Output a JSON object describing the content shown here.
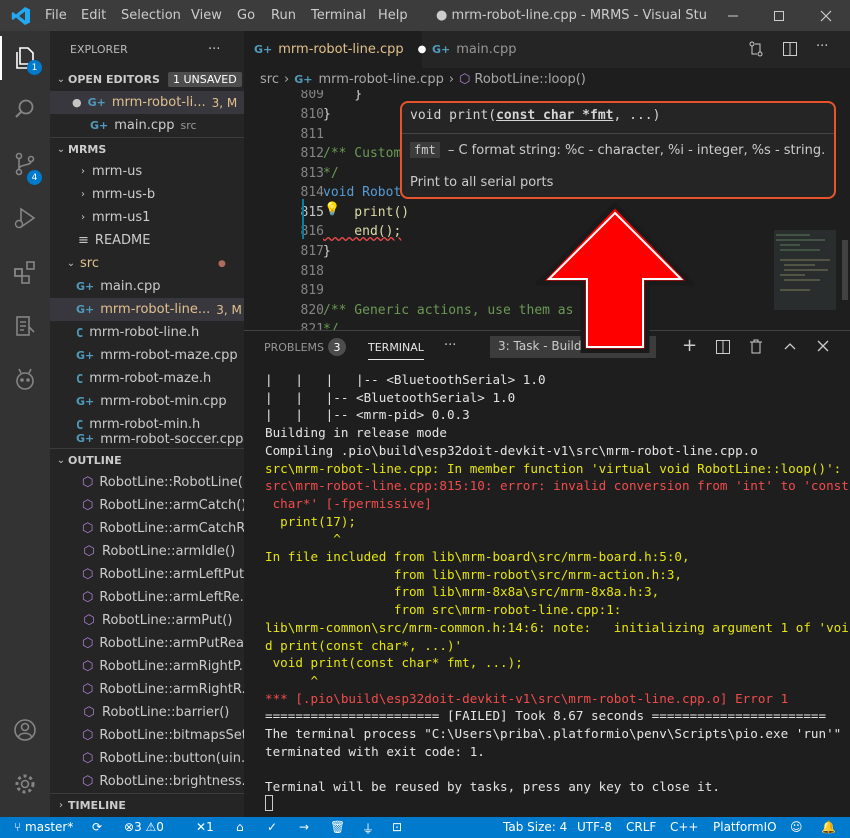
{
  "titlebar": {
    "menus": [
      "File",
      "Edit",
      "Selection",
      "View",
      "Go",
      "Run",
      "Terminal",
      "Help"
    ],
    "title": "● mrm-robot-line.cpp - MRMS - Visual Studio ..."
  },
  "activity": {
    "explorer_badge": "1",
    "scm_badge": "4"
  },
  "sidebar": {
    "header": "EXPLORER",
    "more": "···",
    "open_editors": {
      "label": "OPEN EDITORS",
      "unsaved": "1 UNSAVED",
      "items": [
        {
          "name": "mrm-robot-li...",
          "status": "3, M"
        },
        {
          "name": "main.cpp",
          "dir": "src"
        }
      ]
    },
    "mrms": {
      "label": "MRMS",
      "items": [
        {
          "name": "mrm-us"
        },
        {
          "name": "mrm-us-b"
        },
        {
          "name": "mrm-us1"
        },
        {
          "name": "README"
        },
        {
          "name": "src"
        },
        {
          "name": "main.cpp"
        },
        {
          "name": "mrm-robot-line...",
          "status": "3, M"
        },
        {
          "name": "mrm-robot-line.h"
        },
        {
          "name": "mrm-robot-maze.cpp"
        },
        {
          "name": "mrm-robot-maze.h"
        },
        {
          "name": "mrm-robot-min.cpp"
        },
        {
          "name": "mrm-robot-min.h"
        },
        {
          "name": "mrm-robot-soccer.cpp"
        }
      ]
    },
    "outline": {
      "label": "OUTLINE",
      "items": [
        "RobotLine::RobotLine(...",
        "RobotLine::armCatch()",
        "RobotLine::armCatchR...",
        "RobotLine::armIdle()",
        "RobotLine::armLeftPut()",
        "RobotLine::armLeftRe...",
        "RobotLine::armPut()",
        "RobotLine::armPutRea...",
        "RobotLine::armRightP...",
        "RobotLine::armRightR...",
        "RobotLine::barrier()",
        "RobotLine::bitmapsSet()",
        "RobotLine::button(uin...",
        "RobotLine::brightness..."
      ]
    },
    "timeline": "TIMELINE"
  },
  "tabs": {
    "active": "mrm-robot-line.cpp",
    "second": "main.cpp"
  },
  "breadcrumb": {
    "folder": "src",
    "file": "mrm-robot-line.cpp",
    "symbol": "RobotLine::loop()"
  },
  "editor": {
    "lines": [
      {
        "n": "809",
        "text": "    }"
      },
      {
        "n": "810",
        "text": "}"
      },
      {
        "n": "811",
        "text": ""
      },
      {
        "n": "812",
        "text": "/** Custom"
      },
      {
        "n": "813",
        "text": "*/"
      },
      {
        "n": "814",
        "text": "void Robot"
      },
      {
        "n": "815",
        "text": "    print()"
      },
      {
        "n": "816",
        "text": "    end();"
      },
      {
        "n": "817",
        "text": "}"
      },
      {
        "n": "818",
        "text": ""
      },
      {
        "n": "819",
        "text": ""
      },
      {
        "n": "820",
        "text": "/** Generic actions, use them as"
      },
      {
        "n": "821",
        "text": "*/"
      }
    ]
  },
  "hover": {
    "signature_prefix": "void print(",
    "signature_param": "const char *fmt",
    "signature_suffix": ", ...)",
    "param_name": "fmt",
    "param_doc": "– C format string: %c - character, %i - integer, %s - string.",
    "description": "Print to all serial ports"
  },
  "panel": {
    "tabs": {
      "problems": "PROBLEMS",
      "problems_count": "3",
      "terminal": "TERMINAL",
      "more": "···",
      "task": "3: Task - Build"
    },
    "terminal_lines": [
      {
        "c": "w",
        "t": "|   |   |   |-- <BluetoothSerial> 1.0"
      },
      {
        "c": "w",
        "t": "|   |   |-- <BluetoothSerial> 1.0"
      },
      {
        "c": "w",
        "t": "|   |   |-- <mrm-pid> 0.0.3"
      },
      {
        "c": "w",
        "t": "Building in release mode"
      },
      {
        "c": "w",
        "t": "Compiling .pio\\build\\esp32doit-devkit-v1\\src\\mrm-robot-line.cpp.o"
      },
      {
        "c": "y",
        "t": "src\\mrm-robot-line.cpp: In member function 'virtual void RobotLine::loop()':"
      },
      {
        "c": "r",
        "t": "src\\mrm-robot-line.cpp:815:10: error: invalid conversion from 'int' to 'const"
      },
      {
        "c": "r",
        "t": " char*' [-fpermissive]"
      },
      {
        "c": "y",
        "t": "  print(17);"
      },
      {
        "c": "y",
        "t": "         ^"
      },
      {
        "c": "y",
        "t": "In file included from lib\\mrm-board\\src/mrm-board.h:5:0,"
      },
      {
        "c": "y",
        "t": "                 from lib\\mrm-robot\\src/mrm-action.h:3,"
      },
      {
        "c": "y",
        "t": "                 from lib\\mrm-8x8a\\src/mrm-8x8a.h:3,"
      },
      {
        "c": "y",
        "t": "                 from src\\mrm-robot-line.cpp:1:"
      },
      {
        "c": "y",
        "t": "lib\\mrm-common\\src/mrm-common.h:14:6: note:   initializing argument 1 of 'voi"
      },
      {
        "c": "y",
        "t": "d print(const char*, ...)'"
      },
      {
        "c": "y",
        "t": " void print(const char* fmt, ...);"
      },
      {
        "c": "y",
        "t": "      ^"
      },
      {
        "c": "r",
        "t": "*** [.pio\\build\\esp32doit-devkit-v1\\src\\mrm-robot-line.cpp.o] Error 1"
      },
      {
        "c": "w",
        "t": "======================= [FAILED] Took 8.67 seconds ======================="
      },
      {
        "c": "w",
        "t": "The terminal process \"C:\\Users\\priba\\.platformio\\penv\\Scripts\\pio.exe 'run'\""
      },
      {
        "c": "w",
        "t": "terminated with exit code: 1."
      },
      {
        "c": "w",
        "t": ""
      },
      {
        "c": "w",
        "t": "Terminal will be reused by tasks, press any key to close it."
      }
    ]
  },
  "status": {
    "branch": "master*",
    "errors": "3",
    "warnings": "0",
    "tasks": "1",
    "tab_size": "Tab Size: 4",
    "encoding": "UTF-8",
    "eol": "CRLF",
    "language": "C++",
    "platform": "PlatformIO"
  },
  "colors": {
    "accent": "#007acc",
    "highlight_border": "#e8542a",
    "arrow_red": "#ff0000"
  }
}
